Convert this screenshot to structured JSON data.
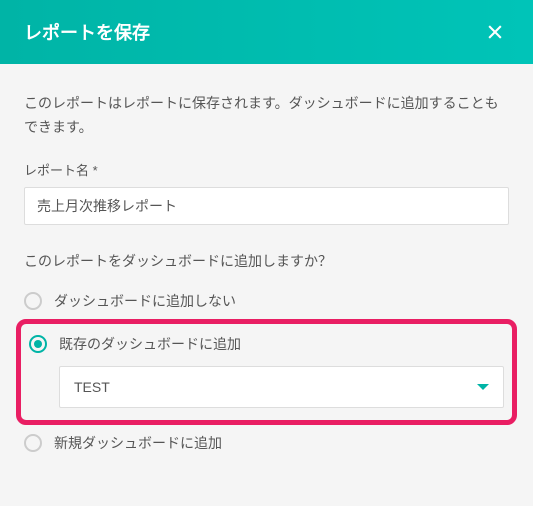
{
  "header": {
    "title": "レポートを保存"
  },
  "body": {
    "description": "このレポートはレポートに保存されます。ダッシュボードに追加することもできます。",
    "report_name_label": "レポート名 *",
    "report_name_value": "売上月次推移レポート",
    "dashboard_question": "このレポートをダッシュボードに追加しますか？",
    "radio_options": {
      "no_add": "ダッシュボードに追加しない",
      "existing": "既存のダッシュボードに追加",
      "new": "新規ダッシュボードに追加"
    },
    "selected_dashboard": "TEST"
  }
}
